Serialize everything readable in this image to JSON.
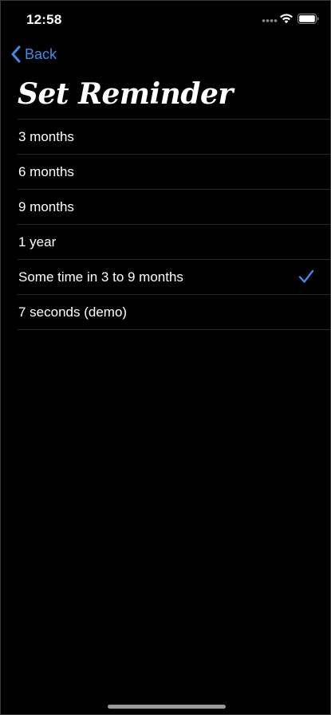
{
  "status_bar": {
    "time": "12:58",
    "icons": [
      "signal-dots-icon",
      "wifi-icon",
      "battery-icon"
    ]
  },
  "nav": {
    "back_label": "Back",
    "back_icon": "chevron-left-icon"
  },
  "page": {
    "title": "Set Reminder"
  },
  "options": [
    {
      "label": "3 months",
      "selected": false
    },
    {
      "label": "6 months",
      "selected": false
    },
    {
      "label": "9 months",
      "selected": false
    },
    {
      "label": "1 year",
      "selected": false
    },
    {
      "label": "Some time in 3 to 9 months",
      "selected": true
    },
    {
      "label": "7 seconds (demo)",
      "selected": false
    }
  ],
  "colors": {
    "background": "#000000",
    "accent": "#3d8ee8",
    "text": "#ffffff",
    "separator": "#2a2a2c"
  }
}
